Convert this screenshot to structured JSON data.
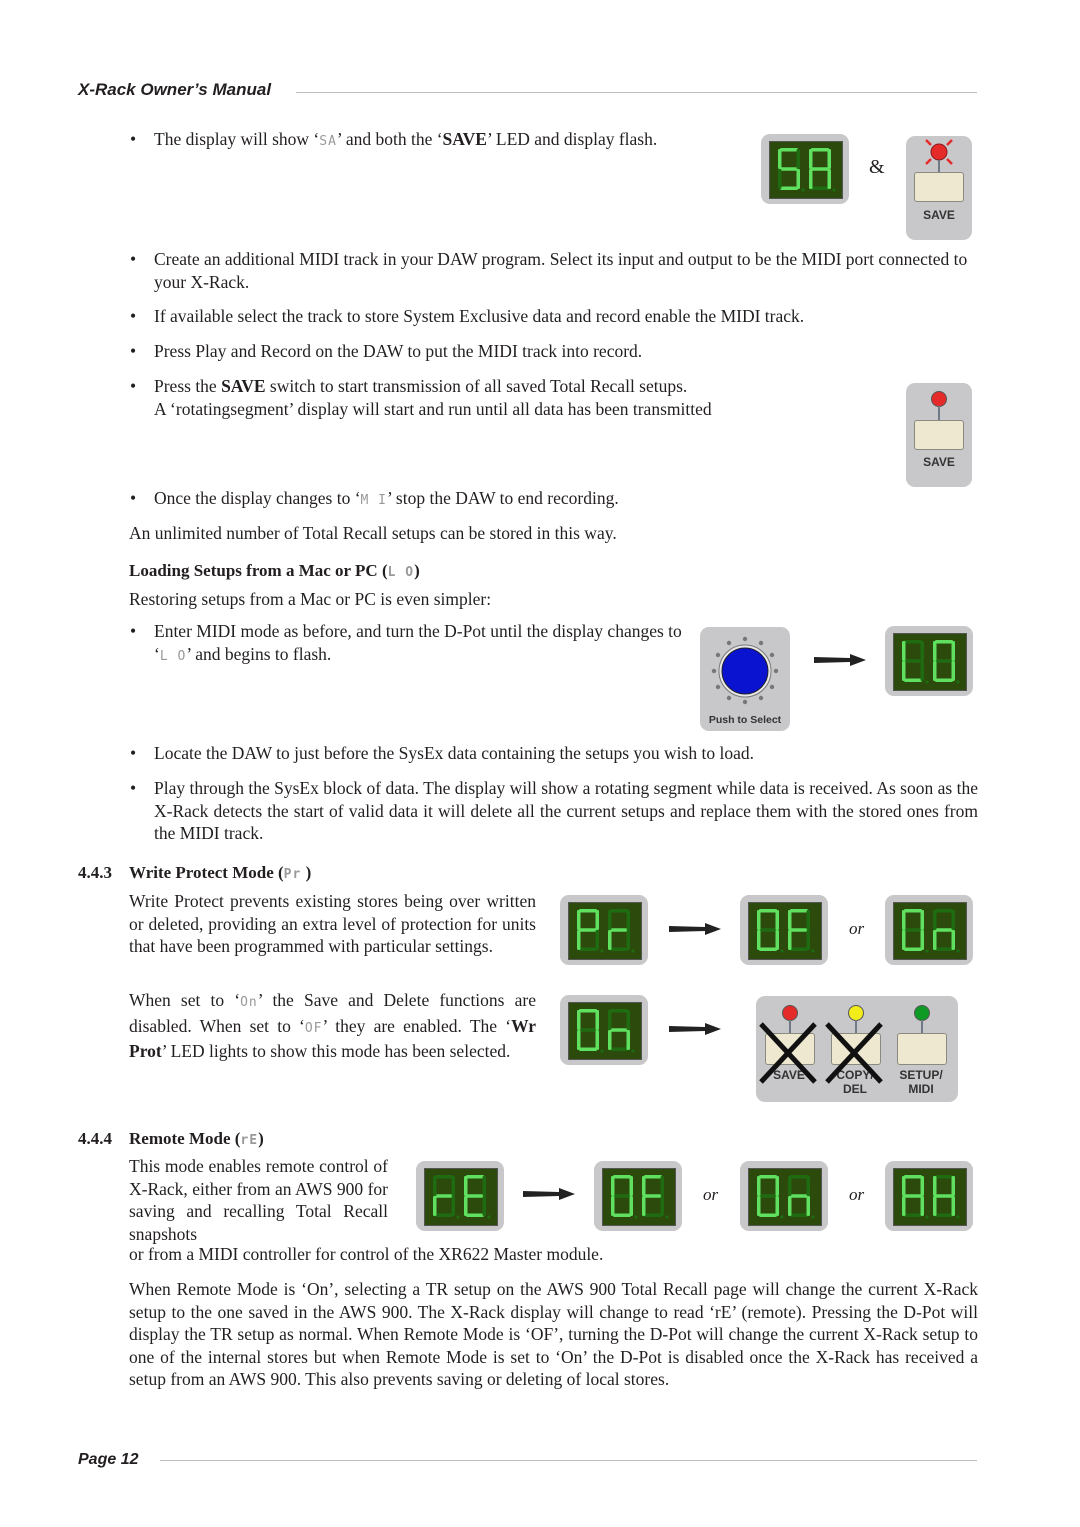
{
  "header": {
    "title": "X-Rack Owner’s Manual"
  },
  "footer": {
    "page_label": "Page 12"
  },
  "section_save": {
    "bullet1": {
      "pre": "The display will show ‘",
      "code": "SA",
      "mid": "’ and both the ‘",
      "bold": "SAVE",
      "post": "’ LED and display flash."
    },
    "ampersand": "&",
    "save_label": "SAVE",
    "bullet2": "Create an additional MIDI track in your DAW program. Select its input and output to be the MIDI port connected to your X-Rack.",
    "bullet3": "If available select the track to store System Exclusive data and record enable the MIDI track.",
    "bullet4": "Press Play and Record on the DAW to put the MIDI track into record.",
    "bullet5": {
      "pre": "Press the ",
      "bold": "SAVE",
      "post": " switch to start transmission of all saved Total Recall setups.",
      "line2": "A ‘rotatingsegment’ display will start and run until all data has been transmitted"
    },
    "save_label2": "SAVE",
    "bullet6": {
      "pre": "Once the display changes to ‘",
      "code": "M I",
      "post": "’ stop the DAW to end recording."
    },
    "para": "An unlimited number of Total Recall setups can be stored in this way."
  },
  "section_load": {
    "heading": {
      "text": "Loading Setups from a Mac or PC (",
      "code": "L O",
      "close": ")"
    },
    "intro": "Restoring setups from a Mac or PC is even simpler:",
    "bullet1": {
      "pre": "Enter MIDI mode as before, and turn the D-Pot until the display changes to ‘",
      "code": "L O",
      "post": "’ and begins to flash."
    },
    "knob_label": "Push to Select",
    "bullet2": "Locate the DAW to just before the SysEx data containing the setups you wish to load.",
    "bullet3": "Play through the SysEx block of data. The display will show a rotating segment while data is received. As soon as the X-Rack detects the start of valid data it will delete all the current setups and replace them with the stored ones from the MIDI track."
  },
  "section_wp": {
    "number": "4.4.3",
    "heading": {
      "text": "Write Protect Mode (",
      "code": "Pr",
      "close": " )"
    },
    "para1": "Write Protect prevents existing stores being over written or deleted, providing an extra level of protection for units that have been programmed with particular settings.",
    "para2": {
      "a": "When set to ‘",
      "code_on": "On",
      "b": "’ the Save and Delete functions are disabled. When set to ‘",
      "code_off": "OF",
      "c": "’ they are enabled. The ‘",
      "bold": "Wr Prot",
      "d": "’ LED lights to show this mode has been selected."
    },
    "or": "or",
    "buttons": [
      {
        "label": "SAVE",
        "led_color": "#e52a2a",
        "crossed": true
      },
      {
        "label": "COPY/\nDEL",
        "led_color": "#f2ec1a",
        "crossed": true
      },
      {
        "label": "SETUP/\nMIDI",
        "led_color": "#0f9a25",
        "crossed": false
      }
    ]
  },
  "section_remote": {
    "number": "4.4.4",
    "heading": {
      "text": "Remote Mode (",
      "code": "rE",
      "close": ")"
    },
    "para1": "This mode enables remote control of X-Rack, either from an AWS 900 for saving and recalling Total Recall snapshots",
    "para1b": "or from a MIDI controller for control of the XR622 Master module.",
    "or1": "or",
    "or2": "or",
    "para2": "When Remote Mode is ‘On’, selecting a TR setup on the AWS 900 Total Recall page will change the current X-Rack setup to the one saved in the AWS 900. The X-Rack display will change to read ‘rE’ (remote). Pressing the D-Pot will display the TR setup as normal. When Remote Mode is ‘OF’, turning the D-Pot will change the current X-Rack setup to one of the internal stores but when Remote Mode is set to ‘On’ the D-Pot is disabled once the X-Rack has received a setup from an AWS 900. This also prevents saving or deleting of local stores."
  },
  "displays": {
    "save_sa": "SA",
    "load_lo": "LO",
    "wp_pr": "Pr",
    "wp_of": "OF",
    "wp_on": "On",
    "wp_on2": "On",
    "re_re": "rE",
    "re_of": "OF",
    "re_on": "On",
    "re_aw": "AH"
  },
  "colors": {
    "seg_on": "#5fe05f",
    "seg_off": "#1f6b12",
    "screen": "#2c4a0c",
    "knob": "#0a14d0"
  }
}
